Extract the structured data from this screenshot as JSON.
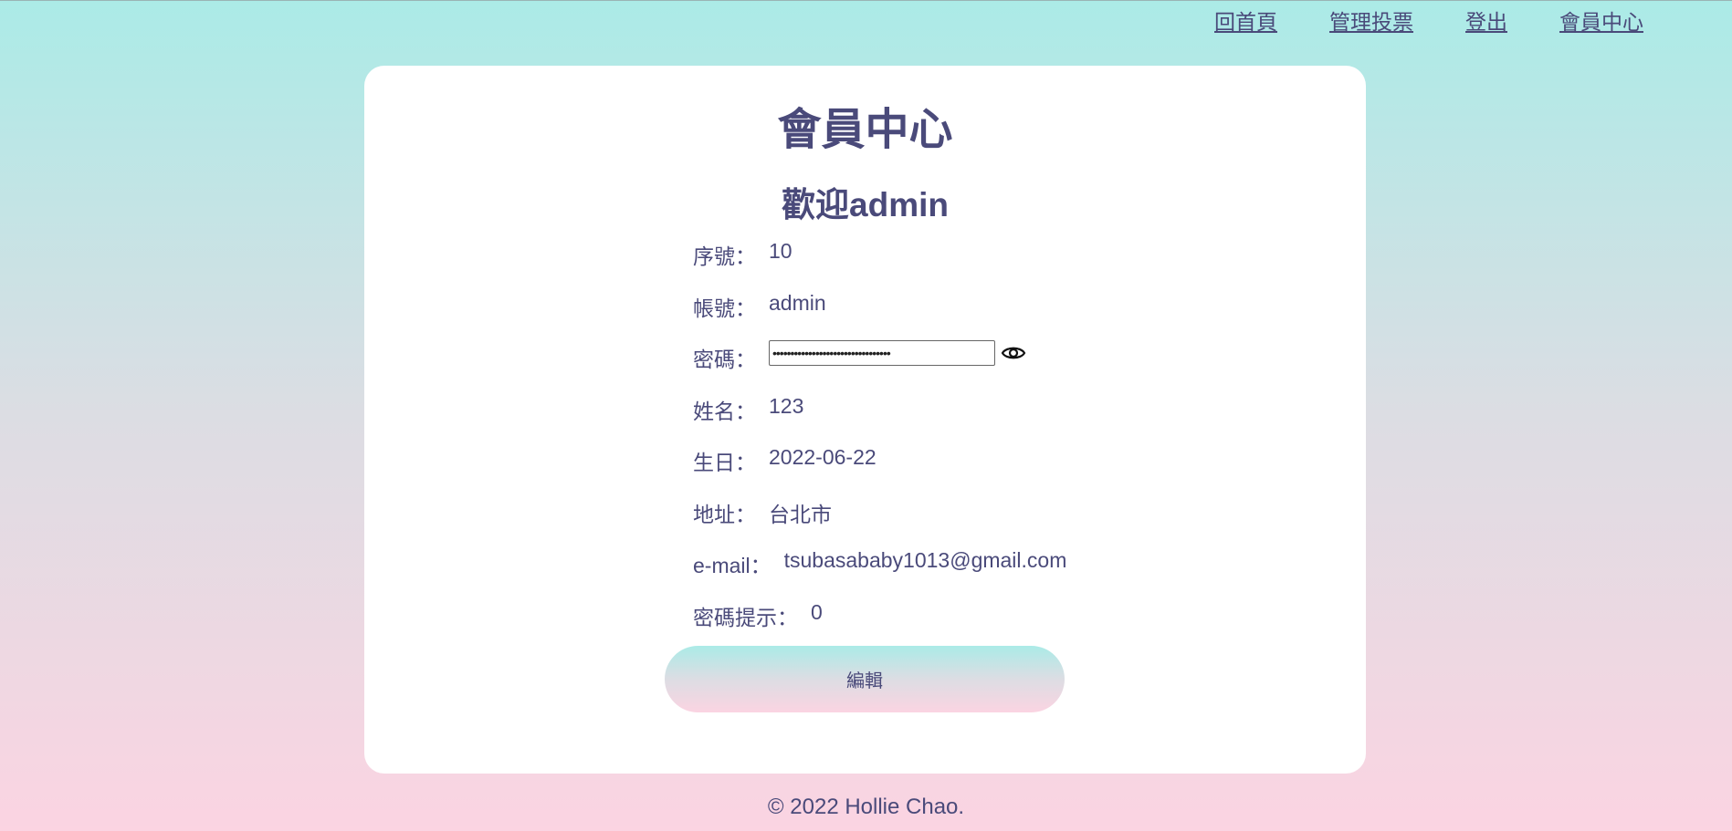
{
  "nav": {
    "home": "回首頁",
    "manage_votes": "管理投票",
    "logout": "登出",
    "member_center": "會員中心"
  },
  "card": {
    "title": "會員中心",
    "welcome": "歡迎admin",
    "fields": [
      {
        "label": "序號：",
        "value": "10"
      },
      {
        "label": "帳號：",
        "value": "admin"
      },
      {
        "label": "密碼：",
        "value": "•••••••••••••••••••••••••••••••••"
      },
      {
        "label": "姓名：",
        "value": "123"
      },
      {
        "label": "生日：",
        "value": "2022-06-22"
      },
      {
        "label": "地址：",
        "value": "台北市"
      },
      {
        "label": "e-mail：",
        "value": "tsubasababy1013@gmail.com"
      },
      {
        "label": "密碼提示：",
        "value": "0"
      }
    ],
    "edit_button": "編輯"
  },
  "footer": {
    "copyright": "© 2022 Hollie Chao."
  },
  "colors": {
    "text": "#4a4a7a",
    "gradient_top": "#abebe7",
    "gradient_bottom": "#fbd4e2",
    "card_bg": "#ffffff"
  },
  "icons": {
    "password_toggle": "eye-icon"
  }
}
